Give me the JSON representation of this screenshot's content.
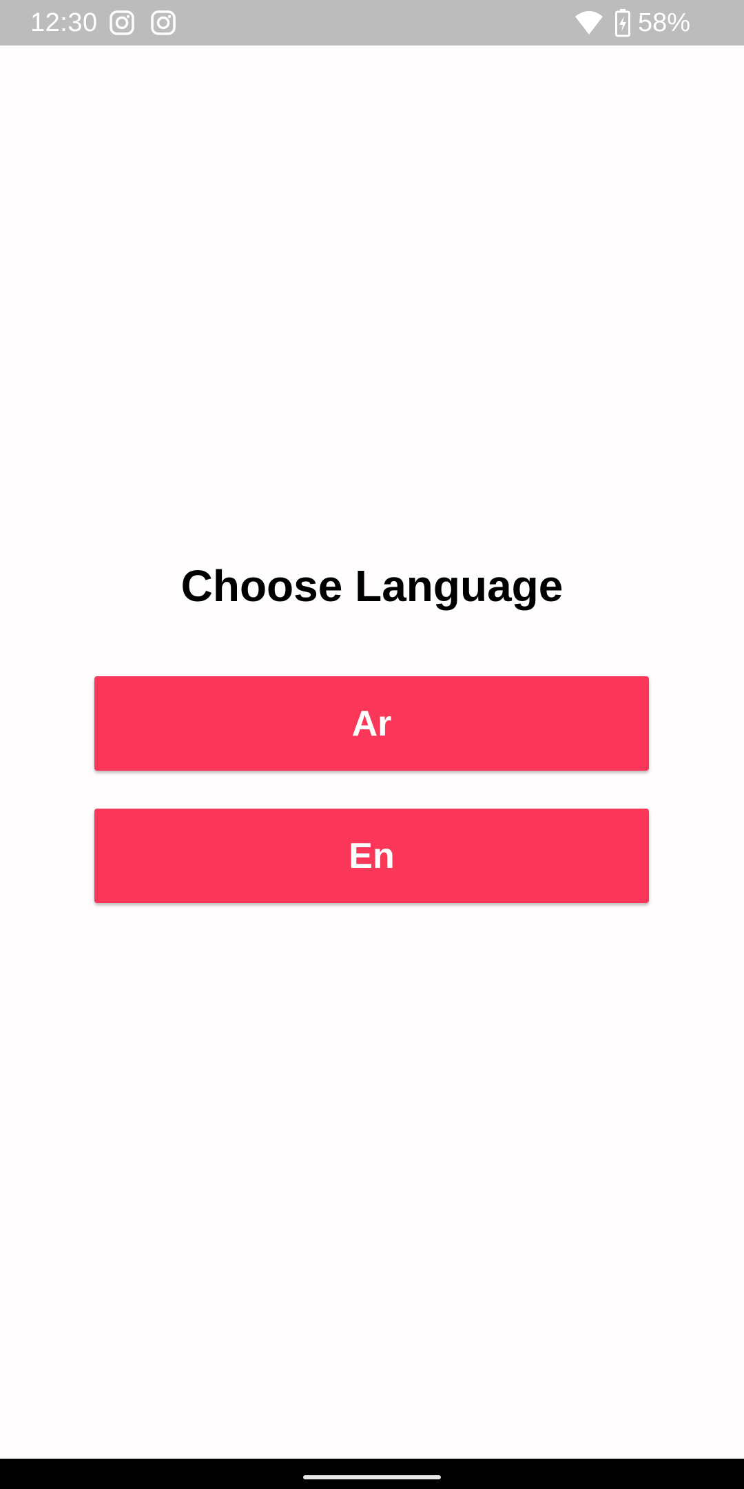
{
  "status_bar": {
    "time": "12:30",
    "battery_percent": "58%",
    "notification_icons": [
      "instagram-icon",
      "instagram-icon"
    ],
    "system_icons": [
      "wifi-icon",
      "battery-charging-icon"
    ]
  },
  "screen": {
    "title": "Choose Language",
    "buttons": [
      {
        "label": "Ar"
      },
      {
        "label": "En"
      }
    ],
    "accent_color": "#fa3659",
    "background_color": "#fffcfd"
  }
}
